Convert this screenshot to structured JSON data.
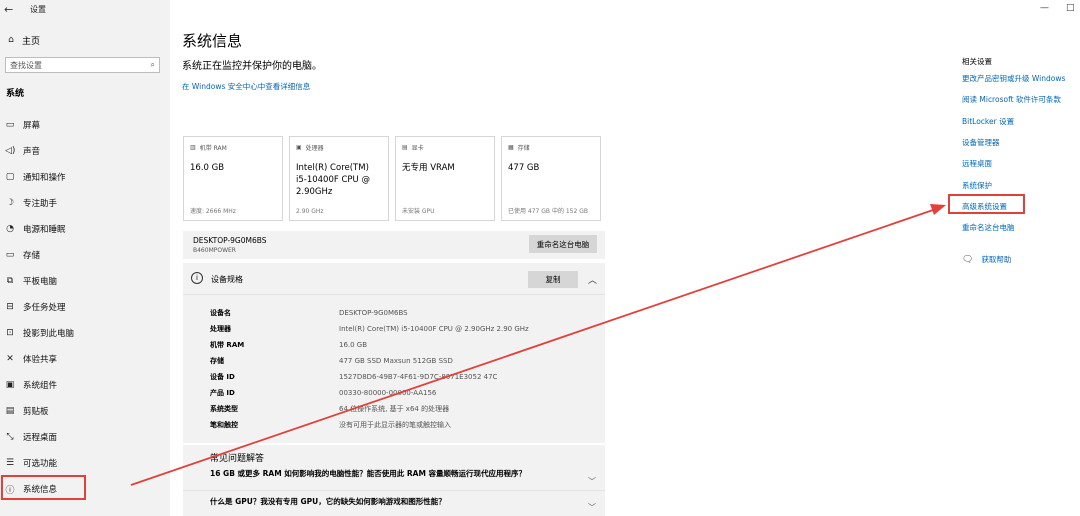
{
  "window": {
    "title": "设置",
    "back_icon": "←",
    "minimize": "—",
    "maximize": "□"
  },
  "sidebar": {
    "home_label": "主页",
    "search_placeholder": "查找设置",
    "section_label": "系统",
    "items": [
      {
        "label": "屏幕",
        "icon": "monitor-icon",
        "glyph": "▭"
      },
      {
        "label": "声音",
        "icon": "speaker-icon",
        "glyph": "🔈"
      },
      {
        "label": "通知和操作",
        "icon": "notification-icon",
        "glyph": "▢"
      },
      {
        "label": "专注助手",
        "icon": "moon-icon",
        "glyph": "☽"
      },
      {
        "label": "电源和睡眠",
        "icon": "power-icon",
        "glyph": "⏻"
      },
      {
        "label": "存储",
        "icon": "storage-icon",
        "glyph": "▭"
      },
      {
        "label": "平板电脑",
        "icon": "tablet-icon",
        "glyph": "⧉"
      },
      {
        "label": "多任务处理",
        "icon": "multitask-icon",
        "glyph": "⊟"
      },
      {
        "label": "投影到此电脑",
        "icon": "project-icon",
        "glyph": "⊡"
      },
      {
        "label": "体验共享",
        "icon": "share-icon",
        "glyph": "✕"
      },
      {
        "label": "系统组件",
        "icon": "components-icon",
        "glyph": "▣"
      },
      {
        "label": "剪贴板",
        "icon": "clipboard-icon",
        "glyph": "▤"
      },
      {
        "label": "远程桌面",
        "icon": "remote-icon",
        "glyph": "⤡"
      },
      {
        "label": "可选功能",
        "icon": "features-icon",
        "glyph": "☰"
      },
      {
        "label": "系统信息",
        "icon": "info-icon",
        "glyph": "ⓘ"
      }
    ]
  },
  "main": {
    "title": "系统信息",
    "subtitle": "系统正在监控并保护你的电脑。",
    "security_link": "在 Windows 安全中心中查看详细信息",
    "cards": [
      {
        "head": "机带 RAM",
        "icon": "ram-icon",
        "glyph": "▥",
        "value": "16.0 GB",
        "foot": "速度: 2666 MHz"
      },
      {
        "head": "处理器",
        "icon": "cpu-icon",
        "glyph": "▣",
        "value": "Intel(R) Core(TM) i5-10400F CPU @ 2.90GHz",
        "foot": "2.90 GHz"
      },
      {
        "head": "显卡",
        "icon": "gpu-icon",
        "glyph": "▤",
        "value": "无专用 VRAM",
        "foot": "未安装 GPU"
      },
      {
        "head": "存储",
        "icon": "storage-card-icon",
        "glyph": "▦",
        "value": "477 GB",
        "foot": "已使用 477 GB 中的 152 GB"
      }
    ],
    "device_name": "DESKTOP-9G0M6BS",
    "device_model": "B460MPOWER",
    "rename_button": "重命名这台电脑",
    "spec_title": "设备规格",
    "copy_button": "复制",
    "specs": [
      {
        "label": "设备名",
        "value": "DESKTOP-9G0M6BS"
      },
      {
        "label": "处理器",
        "value": "Intel(R) Core(TM) i5-10400F CPU @ 2.90GHz   2.90 GHz"
      },
      {
        "label": "机带 RAM",
        "value": "16.0 GB"
      },
      {
        "label": "存储",
        "value": "477 GB SSD Maxsun 512GB SSD"
      },
      {
        "label": "设备 ID",
        "value": "1527D8D6-49B7-4F61-9D7C-8071E3052 47C"
      },
      {
        "label": "产品 ID",
        "value": "00330-80000-00000-AA156"
      },
      {
        "label": "系统类型",
        "value": "64 位操作系统, 基于 x64 的处理器"
      },
      {
        "label": "笔和触控",
        "value": "没有可用于此显示器的笔或触控输入"
      }
    ],
    "faq_title": "常见问题解答",
    "faq_q1": "16 GB 或更多 RAM 如何影响我的电脑性能？能否使用此 RAM 容量顺畅运行现代应用程序？",
    "faq_q2": "什么是 GPU？我没有专用 GPU，它的缺失如何影响游戏和图形性能？"
  },
  "related": {
    "title": "相关设置",
    "links": [
      "更改产品密钥或升级 Windows",
      "阅读 Microsoft 软件许可条款",
      "BitLocker 设置",
      "设备管理器",
      "远程桌面",
      "系统保护",
      "高级系统设置",
      "重命名这台电脑"
    ],
    "help": "获取帮助"
  },
  "annotation": {
    "color": "#e0413b"
  }
}
